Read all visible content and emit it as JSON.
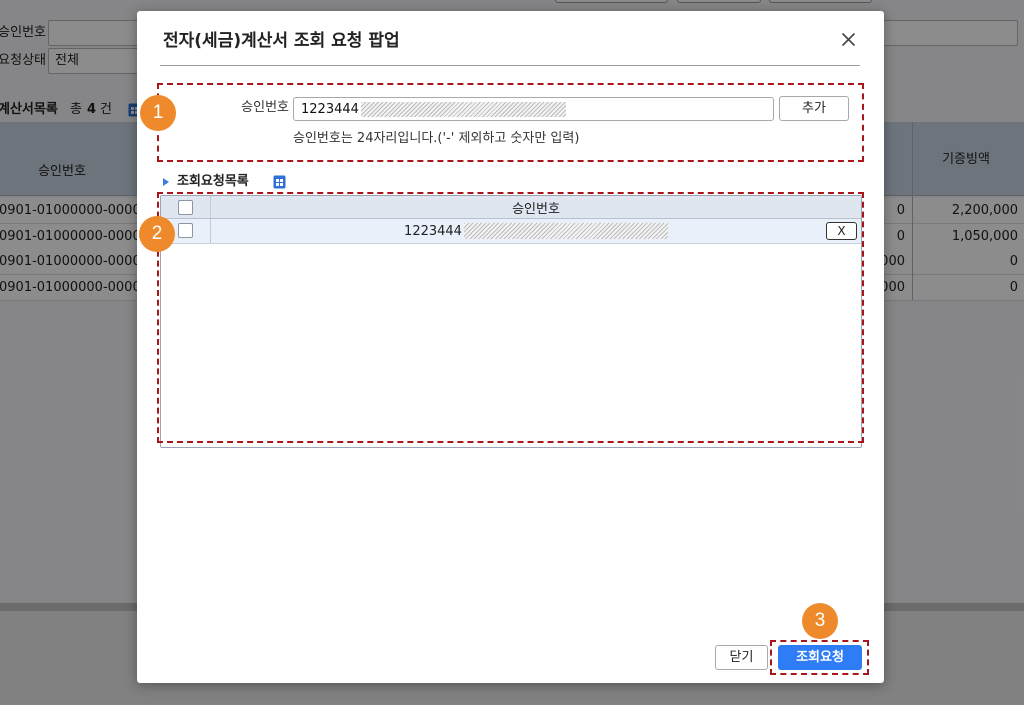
{
  "colors": {
    "badge": "#EF8A2C",
    "highlight": "#A8151B",
    "primary_button": "#2F7DF6",
    "grid_header": "#DFE6F0",
    "grid_selected_row": "#E9F0FA"
  },
  "background_page": {
    "filters": [
      {
        "label": "승인번호",
        "value": ""
      },
      {
        "label": "요청상태",
        "value": "전체"
      }
    ],
    "list": {
      "title": "계산서목록",
      "count_label": "총",
      "count": "4",
      "count_unit": "건",
      "icon": "excel-icon"
    },
    "table": {
      "columns": [
        "승인번호",
        "기증빙액"
      ],
      "rows": [
        {
          "approval_no": "0901-01000000-0000",
          "amount": "0",
          "evidence_amount": "2,200,000"
        },
        {
          "approval_no": "0901-01000000-0000",
          "amount": "0",
          "evidence_amount": "1,050,000"
        },
        {
          "approval_no": "0901-01000000-0000",
          "amount": "000",
          "evidence_amount": "0"
        },
        {
          "approval_no": "0901-01000000-0000",
          "amount": "000",
          "evidence_amount": "0"
        }
      ]
    }
  },
  "modal": {
    "title": "전자(세금)계산서 조회 요청 팝업",
    "close_icon": "close-icon",
    "approval_input": {
      "label": "승인번호",
      "value": "1223444",
      "add_button": "추가",
      "help_text": "승인번호는 24자리입니다.('-' 제외하고 숫자만 입력)"
    },
    "request_list": {
      "title": "조회요청목록",
      "icon": "excel-icon",
      "header": "승인번호",
      "rows": [
        {
          "approval_no": "1223444",
          "remove_button": "X"
        }
      ]
    },
    "footer": {
      "close_button": "닫기",
      "submit_button": "조회요청"
    }
  },
  "annotations": [
    "1",
    "2",
    "3"
  ]
}
